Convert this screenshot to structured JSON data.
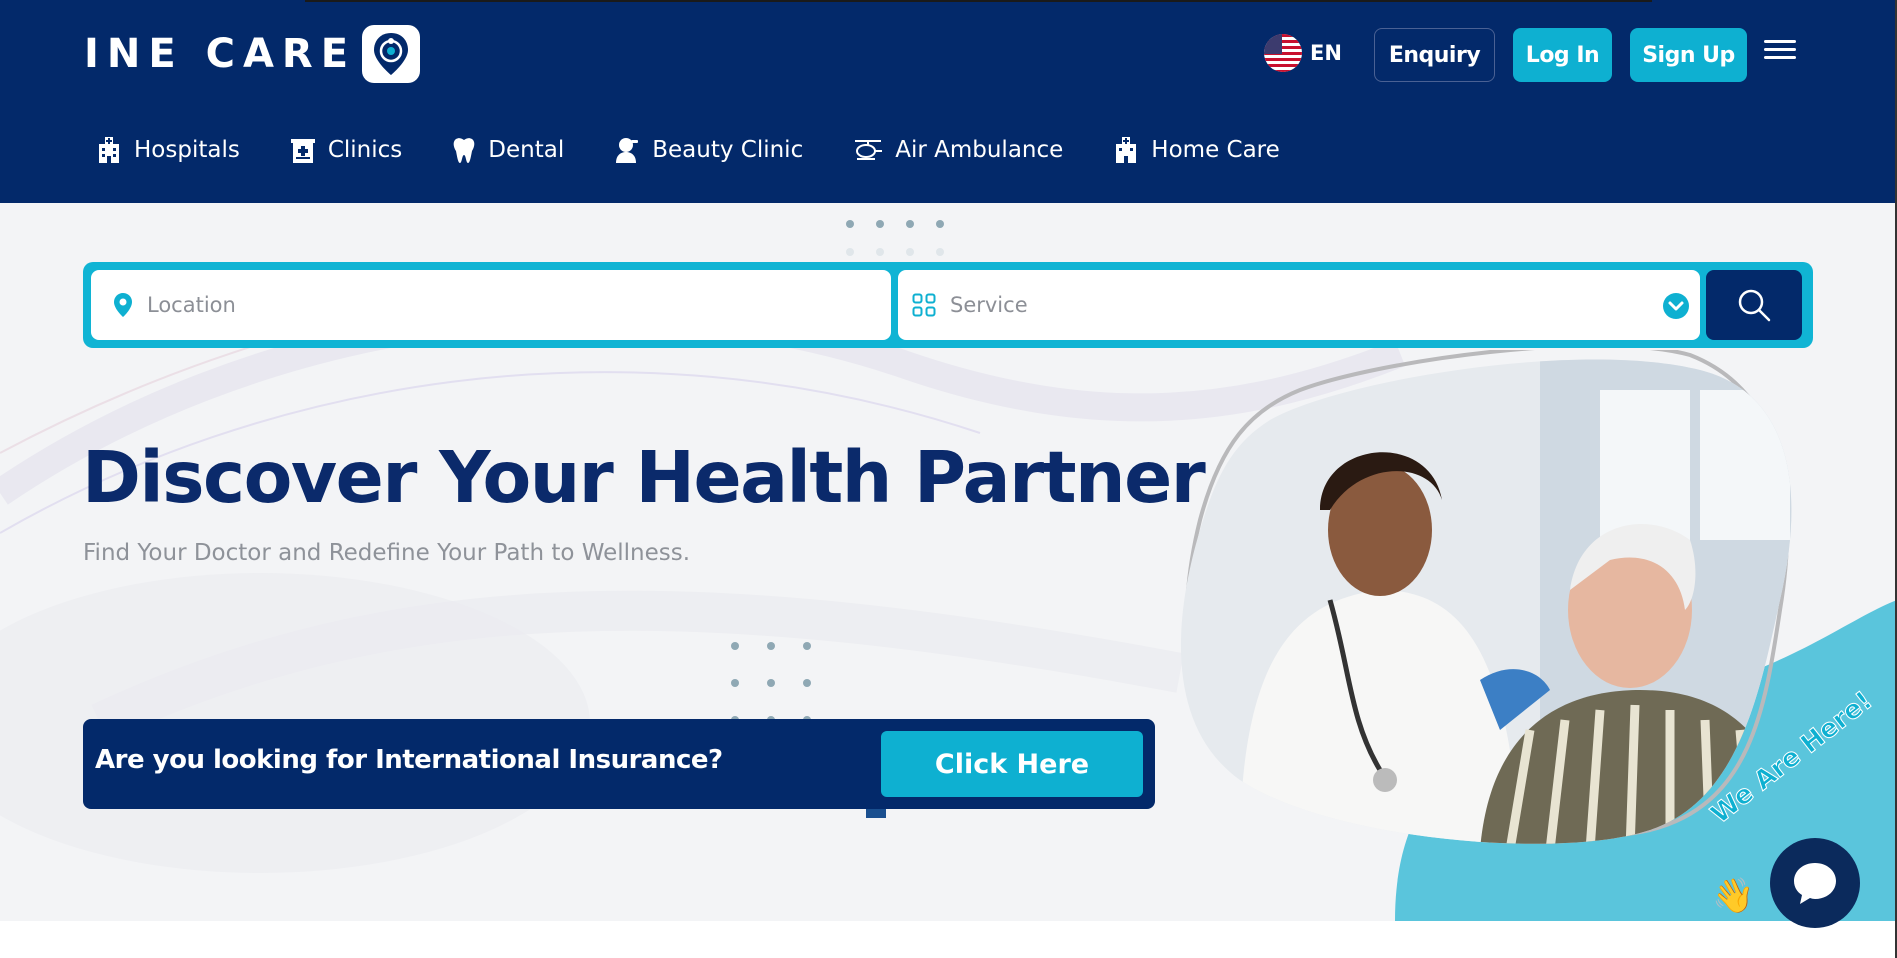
{
  "brand": {
    "name": "INE CARE",
    "navy": "#03296a",
    "teal": "#0eb0d1"
  },
  "header": {
    "language": {
      "code": "EN",
      "flag": "us-flag-icon"
    },
    "enquiry_label": "Enquiry",
    "login_label": "Log In",
    "signup_label": "Sign Up",
    "menu_icon": "hamburger-icon"
  },
  "nav": {
    "items": [
      {
        "label": "Hospitals",
        "icon": "hospital-icon"
      },
      {
        "label": "Clinics",
        "icon": "clinic-icon"
      },
      {
        "label": "Dental",
        "icon": "tooth-icon"
      },
      {
        "label": "Beauty Clinic",
        "icon": "beauty-icon"
      },
      {
        "label": "Air Ambulance",
        "icon": "helicopter-icon"
      },
      {
        "label": "Home Care",
        "icon": "home-care-icon"
      }
    ]
  },
  "search": {
    "location_placeholder": "Location",
    "location_value": "",
    "service_placeholder": "Service",
    "service_value": ""
  },
  "hero": {
    "title": "Discover Your Health Partner",
    "subtitle": "Find Your Doctor and Redefine Your Path to Wellness."
  },
  "insurance": {
    "question": "Are you looking for International Insurance?",
    "button_label": "Click Here"
  },
  "chat": {
    "label": "We Are Here!",
    "hand": "👋"
  }
}
